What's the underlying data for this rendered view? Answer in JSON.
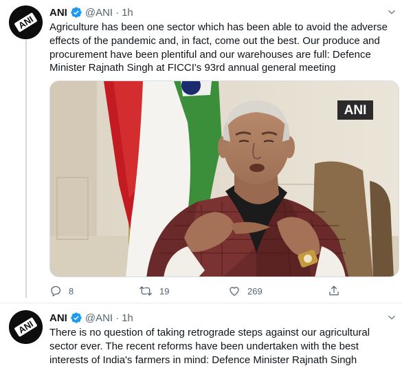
{
  "account": {
    "name": "ANI",
    "handle": "@ANI",
    "avatar_text": "ANI",
    "verified": true
  },
  "tweets": [
    {
      "time": "1h",
      "text": "Agriculture has been one sector which has been able to avoid the adverse effects of the pandemic and, in fact, come out the best. Our produce and procurement have been plentiful and our warehouses are full: Defence Minister Rajnath Singh at FICCI's 93rd annual general meeting",
      "media": {
        "watermark": "ANI"
      },
      "stats": {
        "replies": "8",
        "retweets": "19",
        "likes": "269"
      }
    },
    {
      "time": "1h",
      "text": "There is no question of taking retrograde steps against our agricultural sector ever. The recent reforms have been undertaken with the best interests of India's farmers in mind: Defence Minister Rajnath Singh"
    }
  ],
  "separator": "·",
  "icons": {
    "verified": "verified-badge-icon",
    "caret": "chevron-down-icon",
    "reply": "reply-icon",
    "retweet": "retweet-icon",
    "like": "heart-icon",
    "share": "share-icon"
  },
  "colors": {
    "text": "#0f1419",
    "secondary": "#536471",
    "verified": "#1d9bf0",
    "thread_line": "#cfd9de"
  }
}
